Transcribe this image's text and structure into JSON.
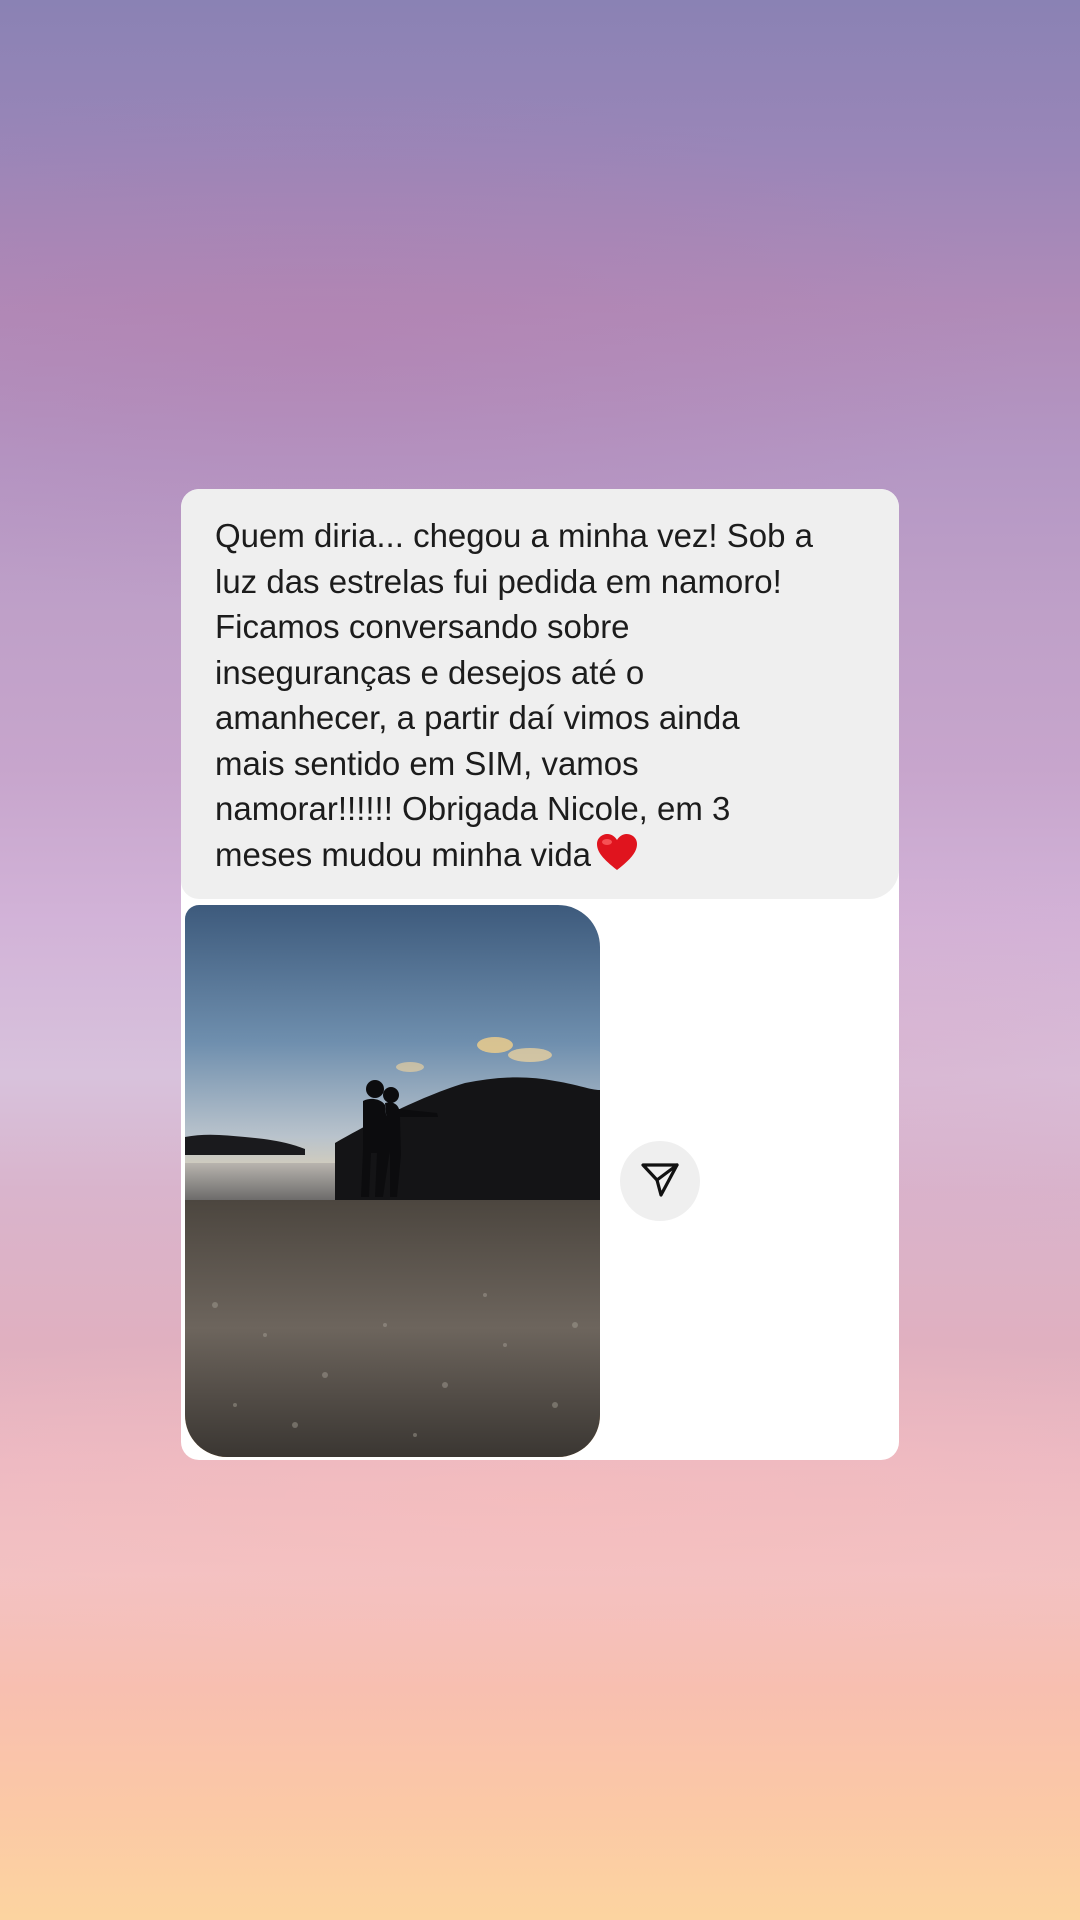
{
  "message": {
    "text": "Quem diria... chegou a minha vez! Sob a\nluz das estrelas fui pedida em namoro!\nFicamos conversando sobre\ninseguranças e desejos até o\namanhecer, a partir daí vimos ainda\nmais sentido em SIM,  vamos\nnamorar!!!!!! Obrigada Nicole,  em 3\nmeses mudou minha vida",
    "emoji": "red-heart",
    "bubble_color": "#efefef"
  },
  "attachment": {
    "type": "photo",
    "subject": "couple-silhouette-beach-sunset"
  },
  "actions": {
    "share_icon": "paper-plane-icon"
  },
  "colors": {
    "card_background": "#ffffff",
    "text": "#1c1c1c"
  }
}
